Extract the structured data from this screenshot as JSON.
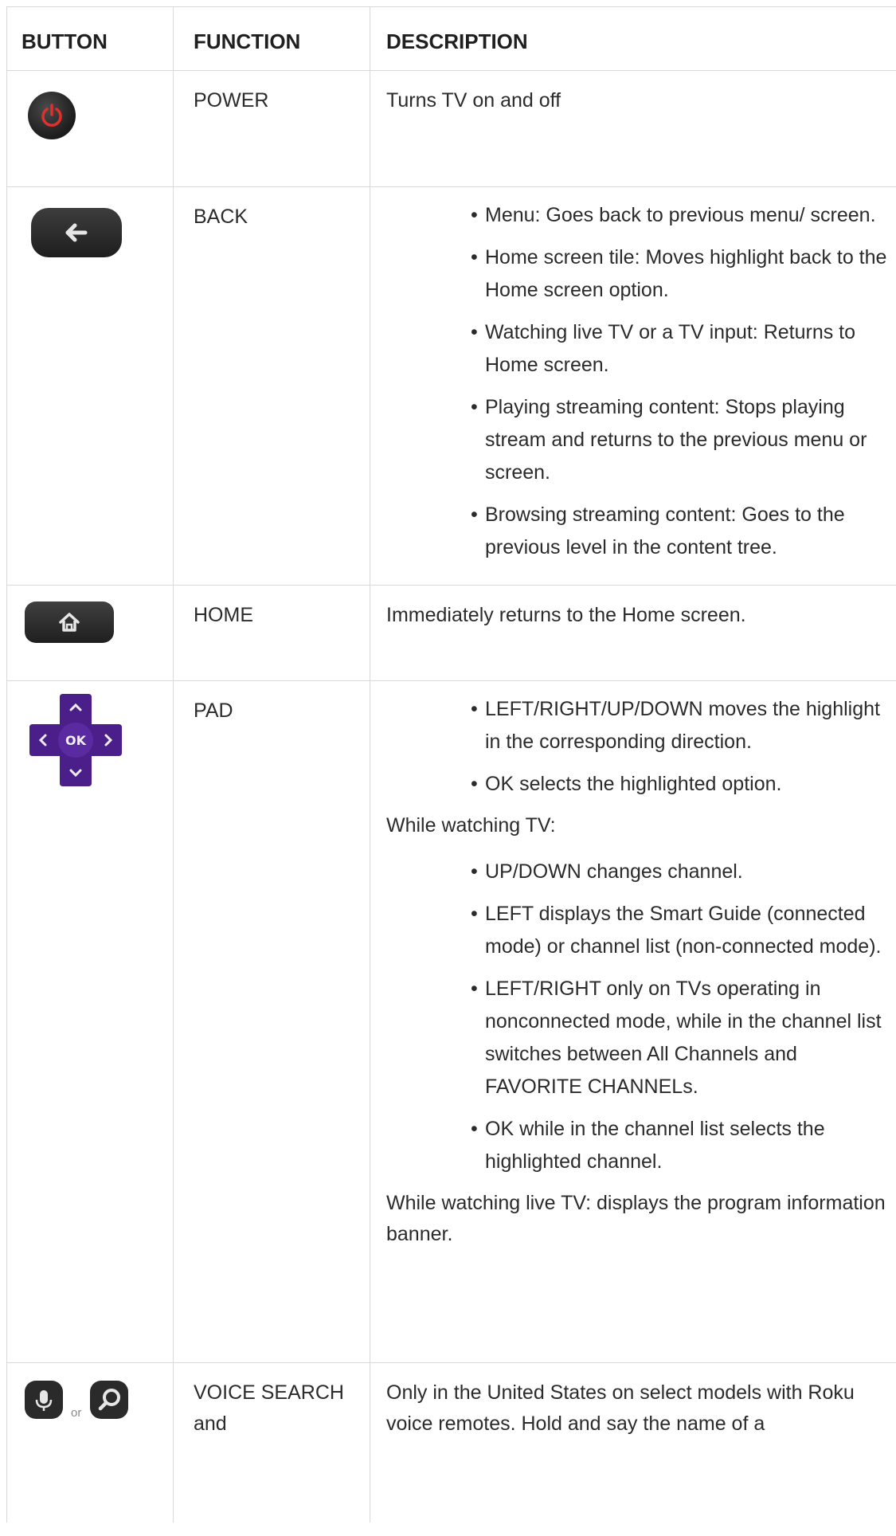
{
  "headers": {
    "button": "BUTTON",
    "function": "FUNCTION",
    "description": "DESCRIPTION"
  },
  "rows": {
    "power": {
      "function": "POWER",
      "description": "Turns TV on and off"
    },
    "back": {
      "function": "BACK",
      "bullets": [
        "Menu: Goes back to previous menu/ screen.",
        "Home screen tile: Moves highlight back to the Home screen option.",
        "Watching live TV or a TV input: Returns to Home screen.",
        "Playing streaming content: Stops playing stream and returns to the previous menu or screen.",
        "Browsing streaming content: Goes to the previous level in the content tree."
      ]
    },
    "home": {
      "function": "HOME",
      "description": "Immediately returns to the Home screen."
    },
    "pad": {
      "function": "PAD",
      "pad_ok_label": "OK",
      "bullets_a": [
        "LEFT/RIGHT/UP/DOWN moves the highlight in the corresponding direction.",
        "OK selects the highlighted option."
      ],
      "watching_tv": "While watching TV:",
      "bullets_b": [
        "UP/DOWN changes channel.",
        "LEFT displays the Smart Guide (connected mode) or channel list (non-connected mode).",
        "LEFT/RIGHT only on TVs operating in nonconnected mode, while in the channel list switches between All Channels and FAVORITE CHANNELs.",
        "OK while in the channel list selects the highlighted channel."
      ],
      "live_tv": "While watching live TV: displays the program information banner."
    },
    "voice": {
      "function": "VOICE SEARCH and",
      "or_label": "or",
      "description": "Only in the United States on select models with Roku voice remotes. Hold and say the name of a"
    }
  }
}
